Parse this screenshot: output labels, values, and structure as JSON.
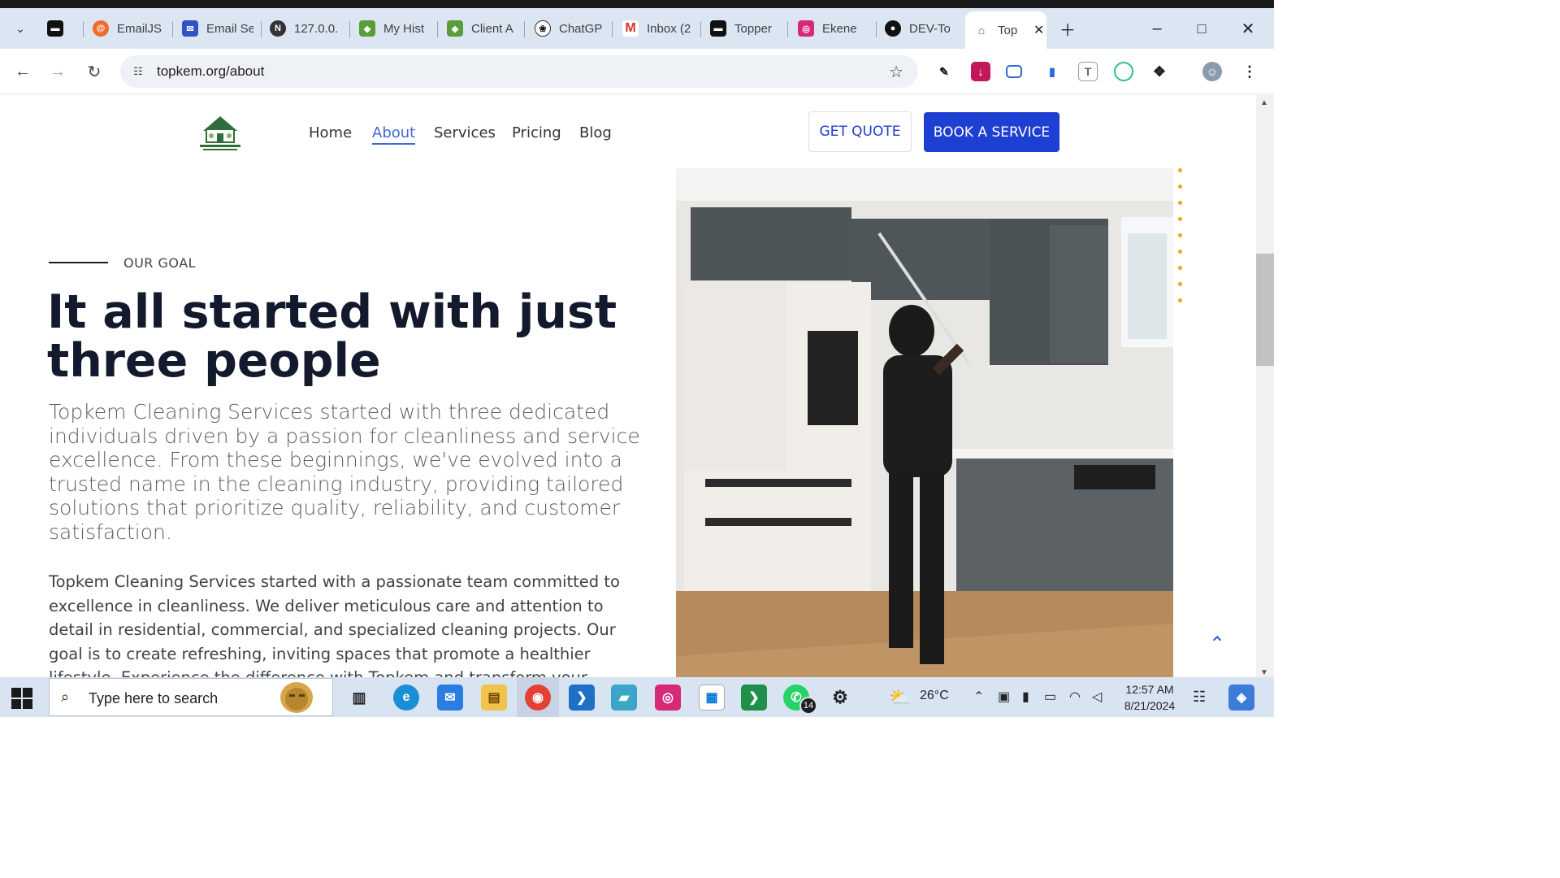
{
  "browser": {
    "tabs": [
      {
        "label": "",
        "icon": "topper-icon"
      },
      {
        "label": "EmailJS",
        "icon": "emailjs-icon"
      },
      {
        "label": "Email Se",
        "icon": "email-service-icon"
      },
      {
        "label": "127.0.0.",
        "icon": "localhost-icon"
      },
      {
        "label": "My Hist",
        "icon": "africa-map-icon"
      },
      {
        "label": "Client A",
        "icon": "africa-map-icon"
      },
      {
        "label": "ChatGP",
        "icon": "chatgpt-icon"
      },
      {
        "label": "Inbox (2",
        "icon": "gmail-icon"
      },
      {
        "label": "Topper",
        "icon": "topper-icon"
      },
      {
        "label": "Ekene",
        "icon": "instagram-icon"
      },
      {
        "label": "DEV-To",
        "icon": "github-icon"
      },
      {
        "label": "Top",
        "icon": "topkem-icon"
      }
    ],
    "url": "topkem.org/about"
  },
  "site": {
    "nav": {
      "home": "Home",
      "about": "About",
      "services": "Services",
      "pricing": "Pricing",
      "blog": "Blog"
    },
    "get_quote": "GET QUOTE",
    "book_service": "BOOK A SERVICE",
    "accent_color": "#1d3fd2"
  },
  "content": {
    "eyebrow": "OUR GOAL",
    "heading": "It all started with just three people",
    "intro": "Topkem Cleaning Services started with three dedicated individuals driven by a passion for cleanliness and service excellence. From these beginnings, we've evolved into a trusted name in the cleaning industry, providing tailored solutions that prioritize quality, reliability, and customer satisfaction.",
    "body": "Topkem Cleaning Services started with a passionate team committed to excellence in cleanliness. We deliver meticulous care and attention to detail in residential, commercial, and specialized cleaning projects. Our goal is to create refreshing, inviting spaces that promote a healthier lifestyle. Experience the difference with Topkem and transform your"
  },
  "taskbar": {
    "search_placeholder": "Type here to search",
    "whatsapp_badge": "14",
    "weather": "26°C",
    "time": "12:57 AM",
    "date": "8/21/2024"
  }
}
